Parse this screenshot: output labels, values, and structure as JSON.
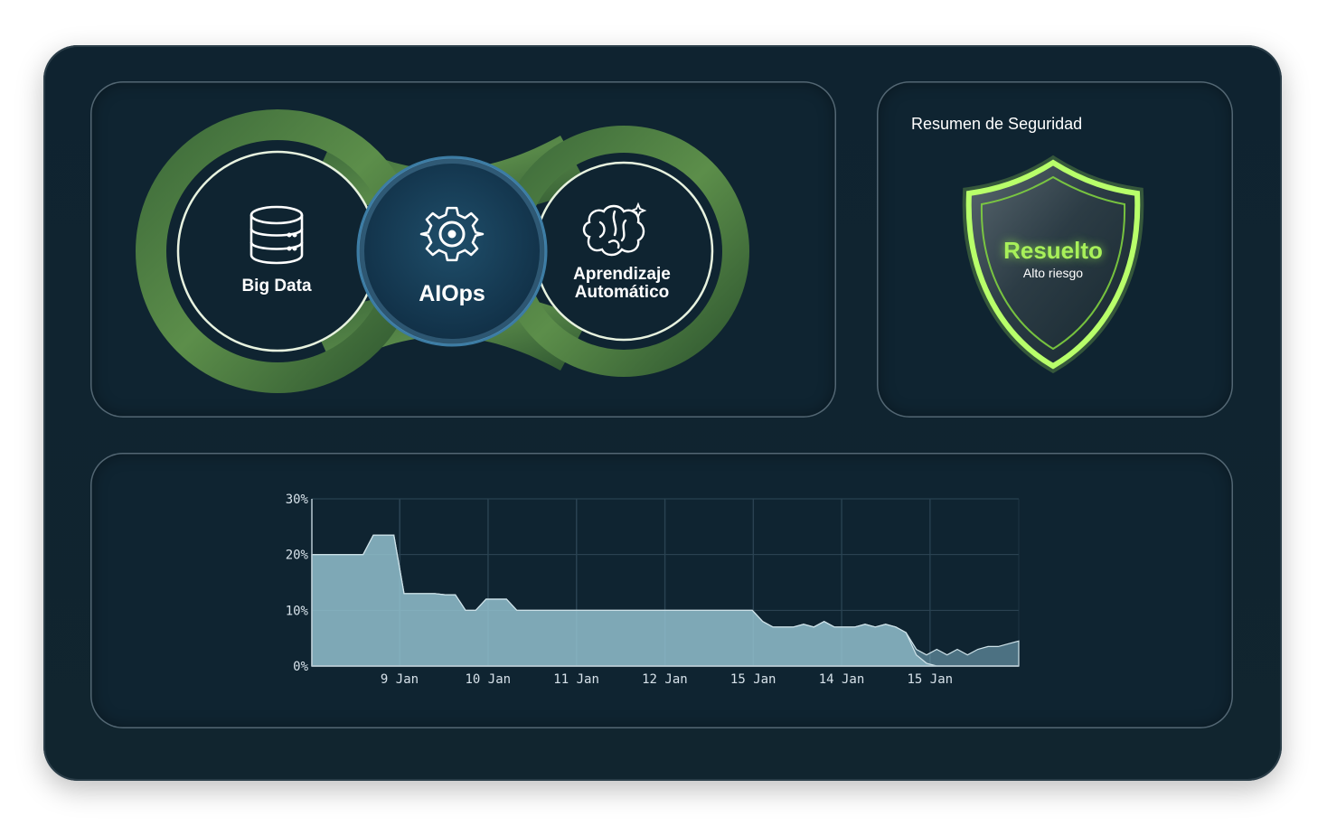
{
  "hub": {
    "left_label": "Big Data",
    "center_label": "AIOps",
    "right_label_line1": "Aprendizaje",
    "right_label_line2": "Automático",
    "icons": {
      "left": "database-icon",
      "center": "gear-icon",
      "right": "brain-sparkle-icon"
    }
  },
  "security": {
    "title": "Resumen de Seguridad",
    "status": "Resuelto",
    "risk": "Alto riesgo",
    "icon": "shield-icon",
    "accent": "#a8f05a"
  },
  "chart_data": {
    "type": "area",
    "y_ticks": [
      "30%",
      "20%",
      "10%",
      "0%"
    ],
    "x_ticks": [
      "9 Jan",
      "10 Jan",
      "11 Jan",
      "12 Jan",
      "15 Jan",
      "14 Jan",
      "15 Jan"
    ],
    "ylim": [
      0,
      30
    ],
    "grid": true,
    "series": [
      {
        "values": [
          20,
          20,
          20,
          20,
          20,
          20,
          23.5,
          23.5,
          23.5,
          13,
          13,
          13,
          13,
          12.8,
          12.8,
          10,
          10,
          12,
          12,
          12,
          10,
          10,
          10,
          10,
          10,
          10,
          10,
          10,
          10,
          10,
          10,
          10,
          10,
          10,
          10,
          10,
          10,
          10,
          10,
          10,
          10,
          10,
          10,
          10,
          8,
          7,
          7,
          7,
          7.5,
          7,
          8,
          7,
          7,
          7,
          7.5,
          7,
          7.5,
          7,
          6,
          3,
          2,
          3,
          2,
          3,
          2,
          3,
          3.5,
          3.5,
          4,
          4.5
        ],
        "color": "#7fb1c4"
      },
      {
        "values": [
          20,
          20,
          20,
          20,
          20,
          20,
          23.5,
          23.5,
          23.5,
          13,
          13,
          13,
          13,
          12.8,
          12.8,
          10,
          10,
          12,
          12,
          12,
          10,
          10,
          10,
          10,
          10,
          10,
          10,
          10,
          10,
          10,
          10,
          10,
          10,
          10,
          10,
          10,
          10,
          10,
          10,
          10,
          10,
          10,
          10,
          10,
          8,
          7,
          7,
          7,
          7.5,
          7,
          8,
          7,
          7,
          7,
          7.5,
          7,
          7.5,
          7,
          6,
          2,
          0.5,
          0,
          0,
          0,
          0,
          0,
          0,
          0,
          0,
          0
        ],
        "color": "#9ac6d3"
      }
    ]
  }
}
